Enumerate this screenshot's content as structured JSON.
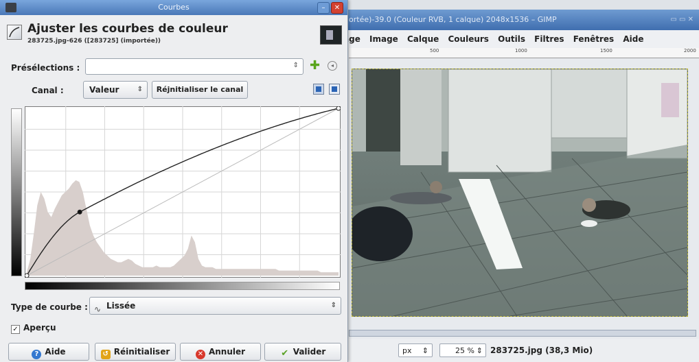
{
  "dialog": {
    "title": "Courbes",
    "header_title": "Ajuster les courbes de couleur",
    "header_subtitle": "283725.jpg-626 ([283725] (importée))",
    "presets_label": "Présélections :",
    "preset_value": "",
    "channel_label": "Canal :",
    "channel_value": "Valeur",
    "reset_channel_label": "Réjnitialiser le canal",
    "curve_type_label": "Type de courbe :",
    "curve_type_value": "Lissée",
    "preview_label": "Aperçu",
    "preview_checked": true,
    "buttons": {
      "help": "Aide",
      "reset": "Réinitialiser",
      "cancel": "Annuler",
      "ok": "Valider"
    },
    "curve": {
      "points": [
        [
          0,
          0
        ],
        [
          0.17,
          0.38
        ],
        [
          1,
          1
        ]
      ],
      "histogram": [
        0.02,
        0.1,
        0.25,
        0.42,
        0.5,
        0.46,
        0.38,
        0.35,
        0.4,
        0.44,
        0.48,
        0.5,
        0.52,
        0.55,
        0.57,
        0.56,
        0.5,
        0.4,
        0.3,
        0.24,
        0.2,
        0.17,
        0.14,
        0.12,
        0.1,
        0.09,
        0.08,
        0.08,
        0.09,
        0.1,
        0.09,
        0.07,
        0.06,
        0.05,
        0.05,
        0.05,
        0.05,
        0.06,
        0.05,
        0.05,
        0.05,
        0.05,
        0.06,
        0.08,
        0.1,
        0.12,
        0.16,
        0.24,
        0.2,
        0.1,
        0.06,
        0.05,
        0.05,
        0.05,
        0.04,
        0.04,
        0.04,
        0.04,
        0.04,
        0.04,
        0.04,
        0.04,
        0.04,
        0.04,
        0.04,
        0.04,
        0.04,
        0.04,
        0.04,
        0.04,
        0.04,
        0.04,
        0.03,
        0.03,
        0.03,
        0.03,
        0.03,
        0.03,
        0.03,
        0.03,
        0.03,
        0.03,
        0.03,
        0.03,
        0.02,
        0.02,
        0.02,
        0.02,
        0.02,
        0.02
      ]
    }
  },
  "gimp": {
    "title": "ortée)-39.0 (Couleur RVB, 1 calque) 2048x1536 – GIMP",
    "menu": [
      "age",
      "Image",
      "Calque",
      "Couleurs",
      "Outils",
      "Filtres",
      "Fenêtres",
      "Aide"
    ],
    "ruler_ticks": [
      "500",
      "1000",
      "1500",
      "2000"
    ],
    "unit": "px",
    "zoom": "25 %",
    "status_file": "283725.jpg (38,3 Mio)"
  },
  "colors": {
    "titlebar": "#4a78b8",
    "histogram": "#d8cfcc",
    "close": "#d34131"
  }
}
